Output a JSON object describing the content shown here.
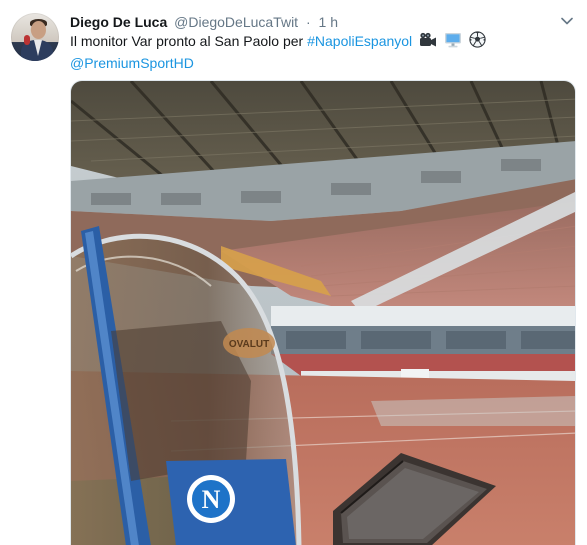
{
  "tweet": {
    "author_name": "Diego De Luca",
    "author_handle": "@DiegoDeLucaTwit",
    "separator": "·",
    "time": "1 h",
    "text_prefix": "Il monitor Var pronto al San Paolo per",
    "hashtag": "#NapoliEspanyol",
    "emojis": [
      "movie-camera",
      "desktop-computer",
      "soccer-ball"
    ],
    "mention": "@PremiumSportHD"
  },
  "media": {
    "description_icon": "stadium-photo",
    "badge_letter": "N",
    "screen_label": "OVALUT"
  }
}
